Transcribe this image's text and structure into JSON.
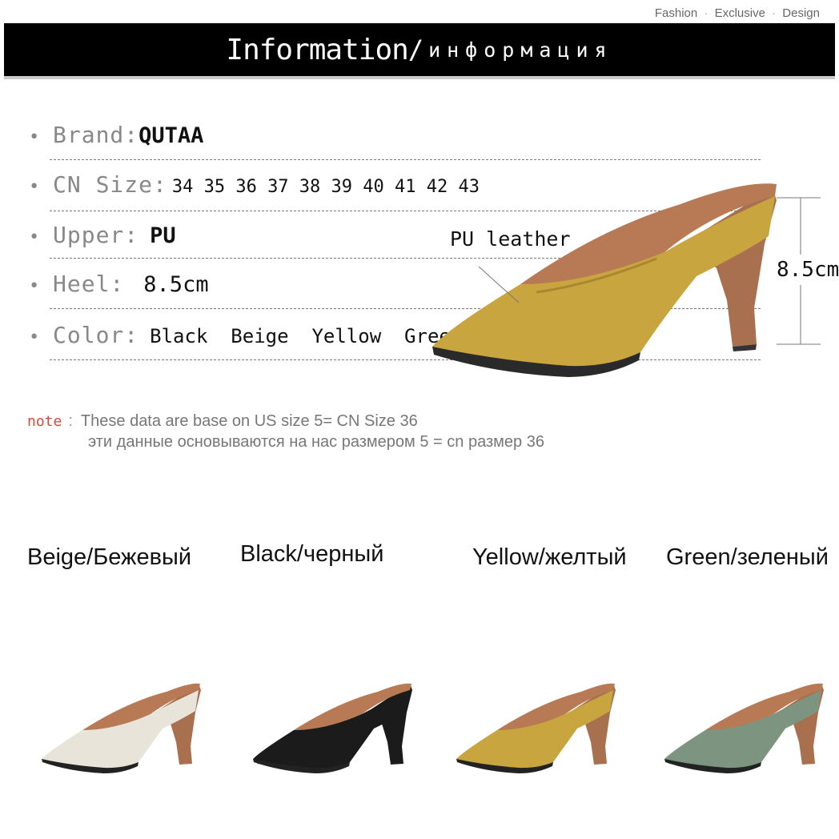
{
  "header": {
    "tagline": [
      "Fashion",
      "Exclusive",
      "Design"
    ],
    "tagline_sep": "·",
    "banner_en": "Information",
    "banner_slash": "/",
    "banner_ru": "информация"
  },
  "specs": [
    {
      "label": "Brand:",
      "value": "QUTAA"
    },
    {
      "label": "CN Size:",
      "value": "34 35 36 37 38 39 40 41 42 43"
    },
    {
      "label": "Upper:",
      "value": "PU"
    },
    {
      "label": "Heel:",
      "value": "8.5cm"
    },
    {
      "label": "Color:",
      "value": "Black  Beige  Yellow  Green"
    }
  ],
  "bullet": "•",
  "product_callout": {
    "material_label": "PU leather",
    "heel_height": "8.5cm"
  },
  "note": {
    "label": "note",
    "colon": ":",
    "line_en": "These data are base on US size 5= CN Size 36",
    "line_ru": "эти данные основываются на нас размером 5 = cn размер 36"
  },
  "variants": [
    {
      "name": "Beige/Бежевый",
      "color": "#e9e4da"
    },
    {
      "name": "Black/черный",
      "color": "#1b1b1b"
    },
    {
      "name": "Yellow/желтый",
      "color": "#c9a540"
    },
    {
      "name": "Green/зеленый",
      "color": "#7d9580"
    }
  ],
  "colors": {
    "banner_bg": "#000000",
    "note_accent": "#d24a3a",
    "main_shoe": "#c9a540",
    "lining": "#b77a55",
    "heel": "#a8704f"
  }
}
